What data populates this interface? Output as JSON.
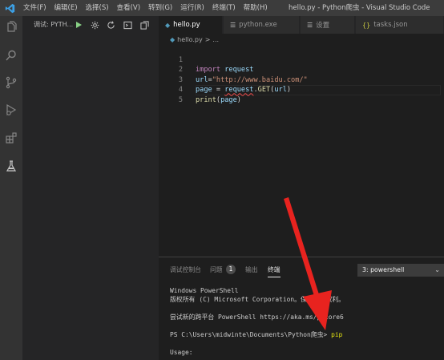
{
  "titlebar": {
    "menu": [
      "文件(F)",
      "编辑(E)",
      "选择(S)",
      "查看(V)",
      "转到(G)",
      "运行(R)",
      "终端(T)",
      "帮助(H)"
    ],
    "window_title": "hello.py - Python爬虫 - Visual Studio Code"
  },
  "activitybar": {
    "icons": [
      "explorer-icon",
      "search-icon",
      "source-control-icon",
      "run-debug-icon",
      "extensions-icon",
      "testing-icon"
    ]
  },
  "debug": {
    "label": "调试: PYTH...",
    "buttons": [
      "start-debug",
      "settings",
      "refresh",
      "debug-console",
      "split"
    ]
  },
  "tabs": [
    {
      "label": "hello.py",
      "icon": "python-icon",
      "active": true
    },
    {
      "label": "python.exe",
      "icon": "file-icon",
      "active": false
    },
    {
      "label": "设置",
      "icon": "settings-icon",
      "active": false
    },
    {
      "label": "tasks.json",
      "icon": "json-icon",
      "active": false
    }
  ],
  "breadcrumb": {
    "file": "hello.py",
    "separator": ">",
    "more": "..."
  },
  "editor": {
    "lines": [
      {
        "num": "1",
        "code": "import request"
      },
      {
        "num": "2",
        "code": "url=\"http://www.baidu.com/\""
      },
      {
        "num": "3",
        "code": "page = request.GET(url)"
      },
      {
        "num": "4",
        "code": "print(page)"
      },
      {
        "num": "5",
        "code": ""
      }
    ]
  },
  "panel": {
    "tabs": [
      "调试控制台",
      "问题",
      "输出",
      "终端"
    ],
    "problems_count": "1",
    "terminal_select": "3: powershell",
    "terminal_lines": [
      "Windows PowerShell",
      "版权所有 (C) Microsoft Corporation。保留所有权利。",
      "",
      "尝试新的跨平台 PowerShell https://aka.ms/pscore6",
      "",
      "PS C:\\Users\\midwinte\\Documents\\Python爬虫> ",
      "",
      "Usage:"
    ],
    "terminal_command": "pip"
  },
  "colors": {
    "accent": "#007acc",
    "arrow": "#e8231f",
    "command": "#e5e510"
  }
}
